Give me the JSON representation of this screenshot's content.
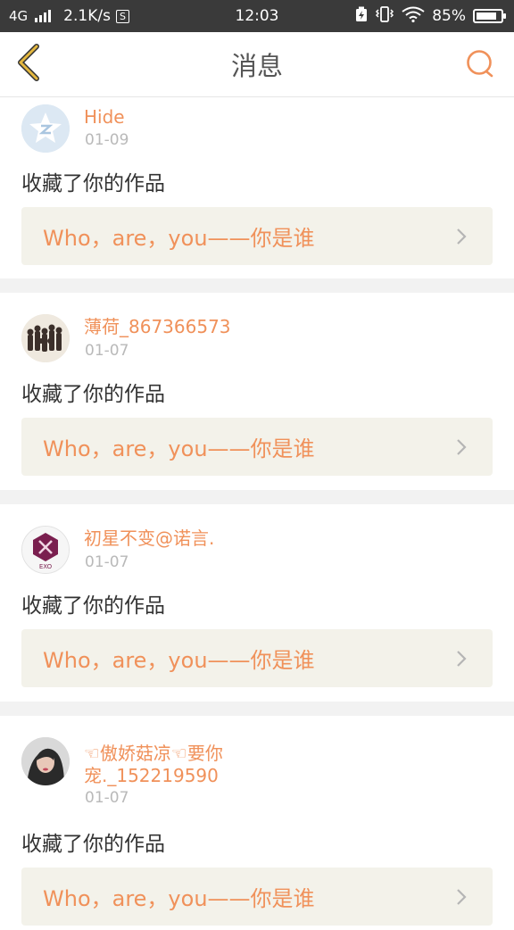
{
  "status_bar": {
    "network": "4G",
    "speed": "2.1K/s",
    "s_badge": "S",
    "time": "12:03",
    "battery_percent": "85%",
    "battery_level": 0.85
  },
  "header": {
    "title": "消息"
  },
  "colors": {
    "accent": "#f0915a",
    "link_bg": "#f3f2ea",
    "status_bar_bg": "#3a3a3a",
    "back_icon": "#e5b840"
  },
  "messages": [
    {
      "username": "Hide",
      "date": "01-09",
      "action": "收藏了你的作品",
      "work_title": "Who，are，you——你是谁",
      "avatar_icon": "qzone-star-icon"
    },
    {
      "username": "薄荷_867366573",
      "date": "01-07",
      "action": "收藏了你的作品",
      "work_title": "Who，are，you——你是谁",
      "avatar_icon": "group-photo-avatar"
    },
    {
      "username": "初星不变@诺言.",
      "date": "01-07",
      "action": "收藏了你的作品",
      "work_title": "Who，are，you——你是谁",
      "avatar_icon": "exo-logo-avatar"
    },
    {
      "username": "☜傲娇菇凉☜要你宠._152219590",
      "date": "01-07",
      "action": "收藏了你的作品",
      "work_title": "Who，are，you——你是谁",
      "avatar_icon": "portrait-avatar"
    }
  ]
}
